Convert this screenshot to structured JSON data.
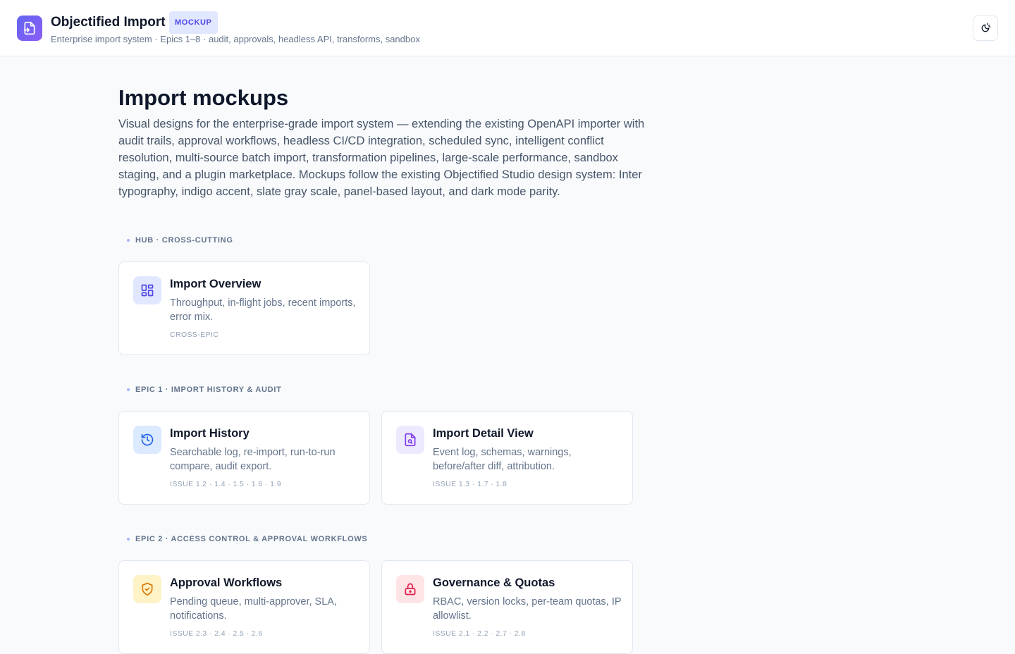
{
  "header": {
    "app_title": "Objectified Import",
    "badge": "MOCKUP",
    "subtitle": "Enterprise import system · Epics 1–8 · audit, approvals, headless API, transforms, sandbox",
    "logo_icon": "import-file-icon",
    "theme_icon": "theme-toggle-icon"
  },
  "main": {
    "title": "Import mockups",
    "description": "Visual designs for the enterprise-grade import system — extending the existing OpenAPI importer with audit trails, approval workflows, headless CI/CD integration, scheduled sync, intelligent conflict resolution, multi-source batch import, transformation pipelines, large-scale performance, sandbox staging, and a plugin marketplace. Mockups follow the existing Objectified Studio design system: Inter typography, indigo accent, slate gray scale, panel-based layout, and dark mode parity."
  },
  "sections": [
    {
      "label": "HUB · CROSS-CUTTING",
      "cards": [
        {
          "title": "Import Overview",
          "description": "Throughput, in-flight jobs, recent imports, error mix.",
          "tag": "CROSS-EPIC",
          "icon": "dashboard-grid-icon",
          "icon_bg": "#e0e7ff",
          "icon_color": "#4f46e5"
        }
      ]
    },
    {
      "label": "EPIC 1 · IMPORT HISTORY & AUDIT",
      "cards": [
        {
          "title": "Import History",
          "description": "Searchable log, re-import, run-to-run compare, audit export.",
          "tag": "ISSUE 1.2 · 1.4 · 1.5 · 1.6 · 1.9",
          "icon": "history-icon",
          "icon_bg": "#dbeafe",
          "icon_color": "#2563eb"
        },
        {
          "title": "Import Detail View",
          "description": "Event log, schemas, warnings, before/after diff, attribution.",
          "tag": "ISSUE 1.3 · 1.7 · 1.8",
          "icon": "file-search-icon",
          "icon_bg": "#ede9fe",
          "icon_color": "#7c3aed"
        }
      ]
    },
    {
      "label": "EPIC 2 · ACCESS CONTROL & APPROVAL WORKFLOWS",
      "cards": [
        {
          "title": "Approval Workflows",
          "description": "Pending queue, multi-approver, SLA, notifications.",
          "tag": "ISSUE 2.3 · 2.4 · 2.5 · 2.6",
          "icon": "shield-check-icon",
          "icon_bg": "#fef3c7",
          "icon_color": "#d97706"
        },
        {
          "title": "Governance & Quotas",
          "description": "RBAC, version locks, per-team quotas, IP allowlist.",
          "tag": "ISSUE 2.1 · 2.2 · 2.7 · 2.8",
          "icon": "lock-icon",
          "icon_bg": "#ffe4e6",
          "icon_color": "#e11d48"
        }
      ]
    }
  ]
}
